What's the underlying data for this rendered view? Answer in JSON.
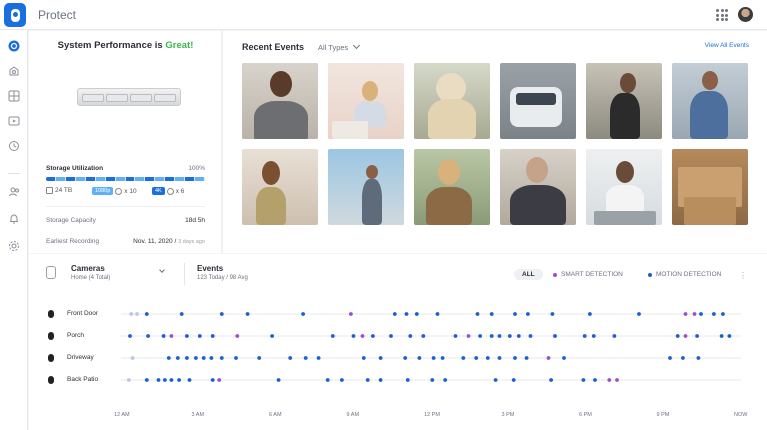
{
  "app": {
    "title": "Protect"
  },
  "performance": {
    "headline_prefix": "System Performance is ",
    "headline_status": "Great!",
    "status_color": "#3cb64b",
    "storage_label": "Storage Utilization",
    "storage_pct": "100%",
    "legend": {
      "total": "24 TB",
      "badge1": "1080p",
      "badge1_count": "x 10",
      "badge2": "4K",
      "badge2_count": "x 6"
    },
    "capacity_label": "Storage Capacity",
    "capacity_value": "18d 5h",
    "earliest_label": "Earliest Recording",
    "earliest_value": "Nov. 11, 2020",
    "earliest_ago": "3 days ago"
  },
  "events": {
    "title": "Recent Events",
    "filter": "All Types",
    "view_all": "View All Events"
  },
  "timeline": {
    "cameras_title": "Cameras",
    "cameras_sub": "Home (4 Total)",
    "events_title": "Events",
    "events_sub": "123 Today / 98 Avg",
    "filter_all": "ALL",
    "filter_smart": "SMART DETECTION",
    "filter_motion": "MOTION DETECTION",
    "colors": {
      "smart": "#9b4fd0",
      "motion": "#1c5fd1",
      "faint": "#b9c6e6"
    },
    "rows": [
      {
        "label": "Front Door",
        "events": [
          {
            "t": 0.4,
            "k": "f"
          },
          {
            "t": 0.62,
            "k": "f"
          },
          {
            "t": 1.0,
            "k": "m"
          },
          {
            "t": 2.35,
            "k": "m"
          },
          {
            "t": 3.9,
            "k": "m"
          },
          {
            "t": 4.9,
            "k": "m"
          },
          {
            "t": 7.05,
            "k": "m"
          },
          {
            "t": 8.9,
            "k": "s"
          },
          {
            "t": 10.6,
            "k": "m"
          },
          {
            "t": 11.05,
            "k": "m"
          },
          {
            "t": 11.45,
            "k": "m"
          },
          {
            "t": 12.25,
            "k": "m"
          },
          {
            "t": 13.8,
            "k": "m"
          },
          {
            "t": 14.35,
            "k": "m"
          },
          {
            "t": 15.25,
            "k": "m"
          },
          {
            "t": 15.75,
            "k": "m"
          },
          {
            "t": 16.7,
            "k": "m"
          },
          {
            "t": 18.15,
            "k": "m"
          },
          {
            "t": 20.05,
            "k": "m"
          },
          {
            "t": 21.85,
            "k": "s"
          },
          {
            "t": 22.2,
            "k": "s"
          },
          {
            "t": 22.45,
            "k": "m"
          },
          {
            "t": 22.95,
            "k": "m"
          },
          {
            "t": 23.3,
            "k": "m"
          }
        ]
      },
      {
        "label": "Porch",
        "events": [
          {
            "t": 0.35,
            "k": "m"
          },
          {
            "t": 1.05,
            "k": "m"
          },
          {
            "t": 1.65,
            "k": "m"
          },
          {
            "t": 1.95,
            "k": "s"
          },
          {
            "t": 2.55,
            "k": "m"
          },
          {
            "t": 3.05,
            "k": "m"
          },
          {
            "t": 3.55,
            "k": "m"
          },
          {
            "t": 4.5,
            "k": "s"
          },
          {
            "t": 5.85,
            "k": "m"
          },
          {
            "t": 8.2,
            "k": "m"
          },
          {
            "t": 9.0,
            "k": "m"
          },
          {
            "t": 9.35,
            "k": "s"
          },
          {
            "t": 9.75,
            "k": "m"
          },
          {
            "t": 10.45,
            "k": "m"
          },
          {
            "t": 11.2,
            "k": "m"
          },
          {
            "t": 11.7,
            "k": "m"
          },
          {
            "t": 12.95,
            "k": "m"
          },
          {
            "t": 13.45,
            "k": "s"
          },
          {
            "t": 13.9,
            "k": "m"
          },
          {
            "t": 14.35,
            "k": "m"
          },
          {
            "t": 14.65,
            "k": "m"
          },
          {
            "t": 15.05,
            "k": "m"
          },
          {
            "t": 15.4,
            "k": "m"
          },
          {
            "t": 15.85,
            "k": "m"
          },
          {
            "t": 16.8,
            "k": "m"
          },
          {
            "t": 17.95,
            "k": "m"
          },
          {
            "t": 18.3,
            "k": "m"
          },
          {
            "t": 19.1,
            "k": "m"
          },
          {
            "t": 21.55,
            "k": "m"
          },
          {
            "t": 21.85,
            "k": "s"
          },
          {
            "t": 22.3,
            "k": "m"
          },
          {
            "t": 23.25,
            "k": "m"
          },
          {
            "t": 23.55,
            "k": "m"
          }
        ]
      },
      {
        "label": "Driveway",
        "events": [
          {
            "t": 0.45,
            "k": "f"
          },
          {
            "t": 1.85,
            "k": "m"
          },
          {
            "t": 2.2,
            "k": "m"
          },
          {
            "t": 2.55,
            "k": "m"
          },
          {
            "t": 2.9,
            "k": "m"
          },
          {
            "t": 3.2,
            "k": "m"
          },
          {
            "t": 3.5,
            "k": "m"
          },
          {
            "t": 3.9,
            "k": "m"
          },
          {
            "t": 4.45,
            "k": "m"
          },
          {
            "t": 5.35,
            "k": "m"
          },
          {
            "t": 6.55,
            "k": "m"
          },
          {
            "t": 7.15,
            "k": "m"
          },
          {
            "t": 7.65,
            "k": "m"
          },
          {
            "t": 9.4,
            "k": "m"
          },
          {
            "t": 10.05,
            "k": "m"
          },
          {
            "t": 11.0,
            "k": "m"
          },
          {
            "t": 11.55,
            "k": "m"
          },
          {
            "t": 12.1,
            "k": "m"
          },
          {
            "t": 12.45,
            "k": "m"
          },
          {
            "t": 13.25,
            "k": "m"
          },
          {
            "t": 13.75,
            "k": "m"
          },
          {
            "t": 14.2,
            "k": "m"
          },
          {
            "t": 14.65,
            "k": "m"
          },
          {
            "t": 15.25,
            "k": "m"
          },
          {
            "t": 15.7,
            "k": "m"
          },
          {
            "t": 16.55,
            "k": "s"
          },
          {
            "t": 17.15,
            "k": "m"
          },
          {
            "t": 21.25,
            "k": "m"
          },
          {
            "t": 21.75,
            "k": "m"
          },
          {
            "t": 22.35,
            "k": "m"
          }
        ]
      },
      {
        "label": "Back Patio",
        "events": [
          {
            "t": 0.3,
            "k": "f"
          },
          {
            "t": 1.0,
            "k": "m"
          },
          {
            "t": 1.45,
            "k": "m"
          },
          {
            "t": 1.7,
            "k": "m"
          },
          {
            "t": 1.95,
            "k": "m"
          },
          {
            "t": 2.25,
            "k": "m"
          },
          {
            "t": 2.65,
            "k": "m"
          },
          {
            "t": 3.55,
            "k": "m"
          },
          {
            "t": 3.8,
            "k": "s"
          },
          {
            "t": 6.1,
            "k": "m"
          },
          {
            "t": 8.0,
            "k": "m"
          },
          {
            "t": 8.55,
            "k": "m"
          },
          {
            "t": 9.55,
            "k": "m"
          },
          {
            "t": 10.05,
            "k": "m"
          },
          {
            "t": 11.1,
            "k": "m"
          },
          {
            "t": 12.05,
            "k": "m"
          },
          {
            "t": 12.55,
            "k": "m"
          },
          {
            "t": 14.5,
            "k": "m"
          },
          {
            "t": 15.2,
            "k": "m"
          },
          {
            "t": 16.65,
            "k": "m"
          },
          {
            "t": 17.9,
            "k": "m"
          },
          {
            "t": 18.35,
            "k": "m"
          },
          {
            "t": 18.9,
            "k": "s"
          },
          {
            "t": 19.2,
            "k": "s"
          }
        ]
      }
    ],
    "ticks": [
      "12 AM",
      "3 AM",
      "6 AM",
      "9 AM",
      "12 PM",
      "3 PM",
      "6 PM",
      "9 PM",
      "NOW"
    ]
  }
}
